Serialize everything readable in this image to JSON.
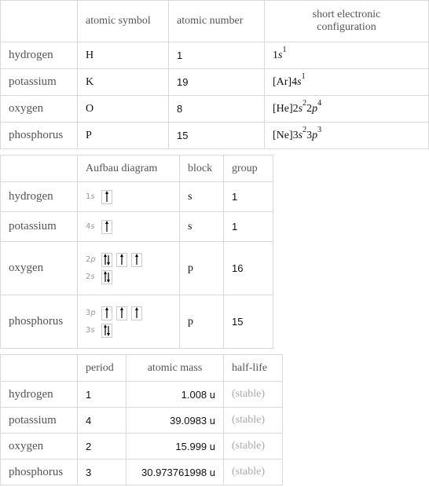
{
  "table1": {
    "headers": [
      "",
      "atomic symbol",
      "atomic number",
      "short electronic configuration"
    ],
    "rows": [
      {
        "name": "hydrogen",
        "symbol": "H",
        "number": "1",
        "config": [
          {
            "t": "1"
          },
          {
            "t": "s",
            "i": true
          },
          {
            "t": "1",
            "sup": true
          }
        ]
      },
      {
        "name": "potassium",
        "symbol": "K",
        "number": "19",
        "config": [
          {
            "t": "[Ar]4"
          },
          {
            "t": "s",
            "i": true
          },
          {
            "t": "1",
            "sup": true
          }
        ]
      },
      {
        "name": "oxygen",
        "symbol": "O",
        "number": "8",
        "config": [
          {
            "t": "[He]2"
          },
          {
            "t": "s",
            "i": true
          },
          {
            "t": "2",
            "sup": true
          },
          {
            "t": "2"
          },
          {
            "t": "p",
            "i": true
          },
          {
            "t": "4",
            "sup": true
          }
        ]
      },
      {
        "name": "phosphorus",
        "symbol": "P",
        "number": "15",
        "config": [
          {
            "t": "[Ne]3"
          },
          {
            "t": "s",
            "i": true
          },
          {
            "t": "2",
            "sup": true
          },
          {
            "t": "3"
          },
          {
            "t": "p",
            "i": true
          },
          {
            "t": "3",
            "sup": true
          }
        ]
      }
    ]
  },
  "table2": {
    "headers": [
      "",
      "Aufbau diagram",
      "block",
      "group"
    ],
    "rows": [
      {
        "name": "hydrogen",
        "orbitals": [
          {
            "n": "1",
            "l": "s",
            "boxes": [
              "up"
            ]
          }
        ],
        "block": "s",
        "group": "1"
      },
      {
        "name": "potassium",
        "orbitals": [
          {
            "n": "4",
            "l": "s",
            "boxes": [
              "up"
            ]
          }
        ],
        "block": "s",
        "group": "1"
      },
      {
        "name": "oxygen",
        "orbitals": [
          {
            "n": "2",
            "l": "p",
            "boxes": [
              "updown",
              "up",
              "up"
            ]
          },
          {
            "n": "2",
            "l": "s",
            "boxes": [
              "updown"
            ]
          }
        ],
        "block": "p",
        "group": "16"
      },
      {
        "name": "phosphorus",
        "orbitals": [
          {
            "n": "3",
            "l": "p",
            "boxes": [
              "up",
              "up",
              "up"
            ]
          },
          {
            "n": "3",
            "l": "s",
            "boxes": [
              "updown"
            ]
          }
        ],
        "block": "p",
        "group": "15"
      }
    ]
  },
  "table3": {
    "headers": [
      "",
      "period",
      "atomic mass",
      "half-life"
    ],
    "rows": [
      {
        "name": "hydrogen",
        "period": "1",
        "mass": "1.008 u",
        "half_life": "(stable)"
      },
      {
        "name": "potassium",
        "period": "4",
        "mass": "39.0983 u",
        "half_life": "(stable)"
      },
      {
        "name": "oxygen",
        "period": "2",
        "mass": "15.999 u",
        "half_life": "(stable)"
      },
      {
        "name": "phosphorus",
        "period": "3",
        "mass": "30.973761998 u",
        "half_life": "(stable)"
      }
    ]
  }
}
